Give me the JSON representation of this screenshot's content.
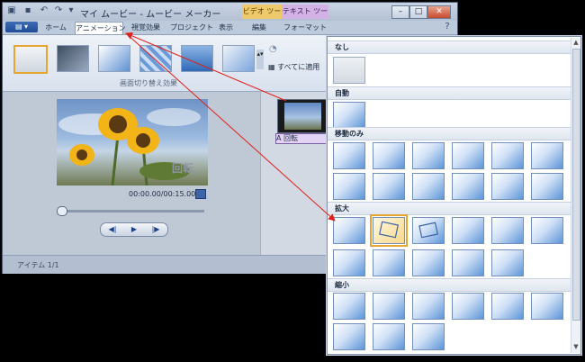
{
  "window": {
    "title": "マイ ムービー - ムービー メーカー",
    "context_groups": {
      "video_tools": "ビデオ ツール",
      "text_tools": "テキスト ツール"
    },
    "window_buttons": {
      "minimize": "–",
      "maximize": "□",
      "close": "✕"
    },
    "help_icon": "?"
  },
  "tabs": {
    "file": "▤ ▾",
    "items": [
      "ホーム",
      "アニメーション",
      "視覚効果",
      "プロジェクト",
      "表示",
      "編集",
      "フォーマット"
    ],
    "active": "アニメーション"
  },
  "ribbon": {
    "group_label": "画面切り替え効果",
    "apply_all": "すべてに適用",
    "pan_zoom_icon": "pan-zoom-icon"
  },
  "preview": {
    "overlay_text": "回転",
    "timecode": "00:00.00/00:15.00"
  },
  "storyboard": {
    "clip_label": "A 回転"
  },
  "status": {
    "text": "アイテム 1/1"
  },
  "gallery": {
    "sections": {
      "none": "なし",
      "auto": "自動",
      "pan": "移動のみ",
      "zoom_in": "拡大",
      "zoom_out": "縮小"
    },
    "selected_tile": "zoom-in-rotate"
  },
  "colors": {
    "arrow": "#e0201a",
    "selection": "#e6a631",
    "active_clip": "#e3d4f5"
  }
}
